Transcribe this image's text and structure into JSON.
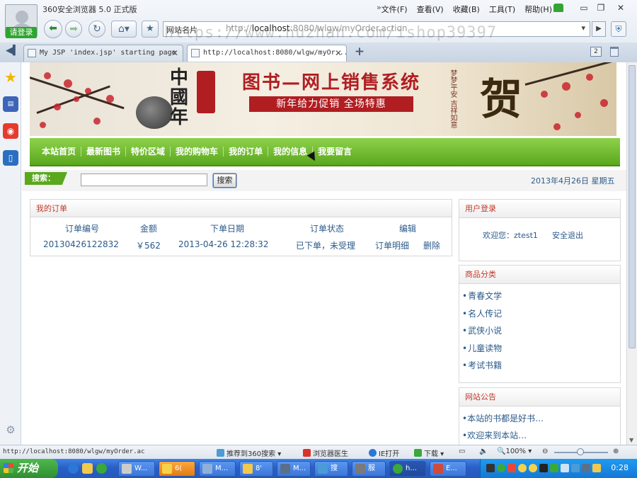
{
  "browser": {
    "app_title": "360安全浏览器 5.0 正式版",
    "login_badge": "请登录",
    "menus": [
      "文件(F)",
      "查看(V)",
      "收藏(B)",
      "工具(T)",
      "帮助(H)"
    ],
    "menu_arrows": "»",
    "address_site": "网站名片",
    "address_url_prefix": "http://",
    "address_host": "localhost",
    "address_url_rest": ":8080/wlgw/myOrder.action",
    "watermark": "https://www.huzhan.com/ishop39397",
    "tabs": [
      {
        "title": "My JSP 'index.jsp' starting page",
        "active": false
      },
      {
        "title": "http://localhost:8080/wlgw/myOr...",
        "active": true
      }
    ],
    "tab_count": "2"
  },
  "site": {
    "banner_logo_chars": "中國年",
    "banner_title": "图书—网上销售系统",
    "banner_subtitle": "新年给力促销 全场特惠",
    "banner_gold_char": "贺",
    "banner_side_text": "梦梦平安 吉祥如意",
    "nav": [
      "本站首页",
      "最新图书",
      "特价区域",
      "我的购物车",
      "我的订单",
      "我的信息",
      "我要留言"
    ],
    "search_label": "搜索：",
    "search_value": "",
    "search_button": "搜索",
    "date": "2013年4月26日 星期五"
  },
  "orders": {
    "title": "我的订单",
    "headers": [
      "订单编号",
      "金额",
      "下单日期",
      "订单状态",
      "编辑"
    ],
    "rows": [
      {
        "id": "20130426122832",
        "amount": "￥562",
        "date": "2013-04-26 12:28:32",
        "status": "已下单，未受理",
        "detail": "订单明细",
        "delete": "删除"
      }
    ]
  },
  "user_panel": {
    "title": "用户登录",
    "welcome": "欢迎您：ztest1",
    "logout": "安全退出"
  },
  "categories": {
    "title": "商品分类",
    "items": [
      "青春文学",
      "名人传记",
      "武侠小说",
      "儿童读物",
      "考试书籍"
    ]
  },
  "notice": {
    "title": "网站公告",
    "items": [
      "本站的书都是好书…",
      "欢迎来到本站…"
    ]
  },
  "statusbar": {
    "url": "http://localhost:8080/wlgw/myOrder.ac",
    "recommend": "推荐到360搜索",
    "doctor": "浏览器医生",
    "ie_open": "IE打开",
    "download": "下载",
    "zoom": "100%"
  },
  "taskbar": {
    "start": "开始",
    "tasks": [
      "W...",
      "6(",
      "M...",
      "8'",
      "M...",
      "搜",
      "服",
      "h...",
      "E..."
    ],
    "clock": "0:28"
  }
}
